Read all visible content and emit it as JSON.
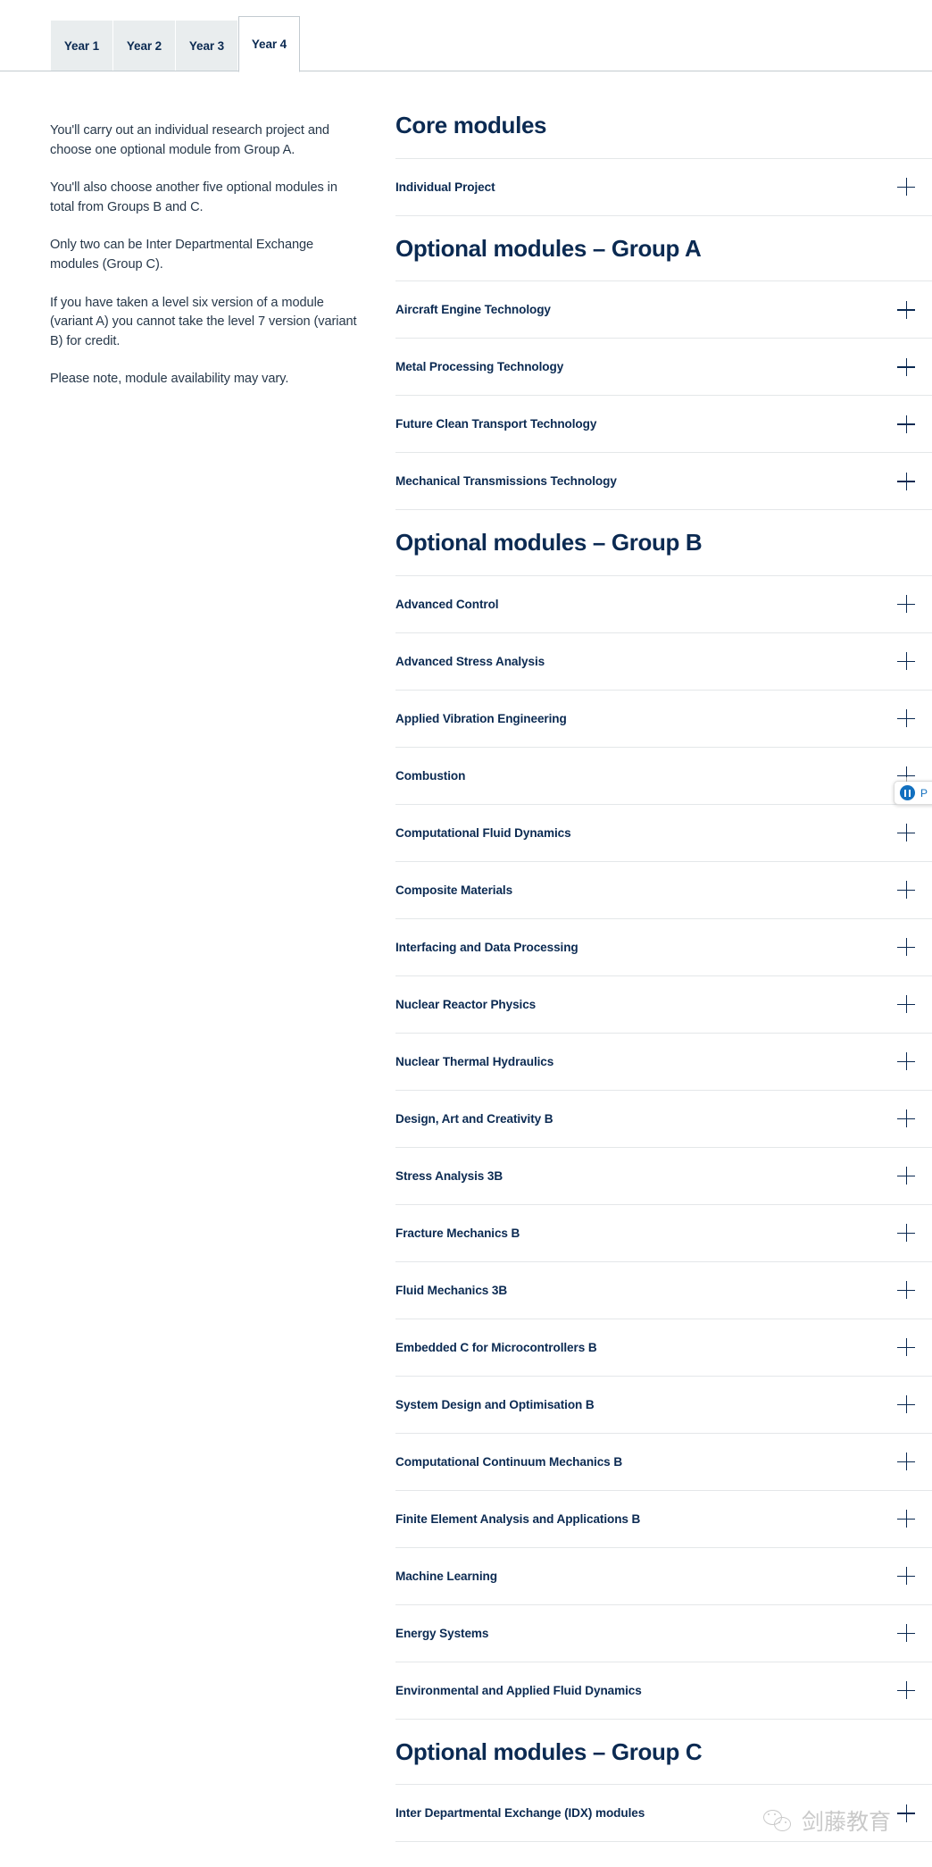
{
  "tabs": [
    {
      "label": "Year 1",
      "active": false
    },
    {
      "label": "Year 2",
      "active": false
    },
    {
      "label": "Year 3",
      "active": false
    },
    {
      "label": "Year 4",
      "active": true
    }
  ],
  "intro": {
    "paragraphs": [
      "You'll carry out an individual research project and choose one optional module from Group A.",
      "You'll also choose another five optional modules in total from Groups B and C.",
      "Only two can be Inter Departmental Exchange modules (Group C).",
      "If you have taken a level six version of a module (variant A) you cannot take the level 7 version (variant B) for credit.",
      "Please note, module availability may vary."
    ]
  },
  "module_groups": [
    {
      "heading": "Core modules",
      "modules": [
        {
          "title": "Individual Project",
          "expand_icon": "plus-icon"
        }
      ]
    },
    {
      "heading": "Optional modules – Group A",
      "modules": [
        {
          "title": "Aircraft Engine Technology",
          "expand_icon": "plus-icon"
        },
        {
          "title": "Metal Processing Technology",
          "expand_icon": "plus-icon"
        },
        {
          "title": "Future Clean Transport Technology",
          "expand_icon": "plus-icon"
        },
        {
          "title": "Mechanical Transmissions Technology",
          "expand_icon": "plus-icon"
        }
      ]
    },
    {
      "heading": "Optional modules – Group B",
      "modules": [
        {
          "title": "Advanced Control",
          "expand_icon": "plus-icon"
        },
        {
          "title": "Advanced Stress Analysis",
          "expand_icon": "plus-icon"
        },
        {
          "title": "Applied Vibration Engineering",
          "expand_icon": "plus-icon"
        },
        {
          "title": "Combustion",
          "expand_icon": "plus-icon"
        },
        {
          "title": "Computational Fluid Dynamics",
          "expand_icon": "plus-icon"
        },
        {
          "title": "Composite Materials",
          "expand_icon": "plus-icon"
        },
        {
          "title": "Interfacing and Data Processing",
          "expand_icon": "plus-icon"
        },
        {
          "title": "Nuclear Reactor Physics",
          "expand_icon": "plus-icon"
        },
        {
          "title": "Nuclear Thermal Hydraulics",
          "expand_icon": "plus-icon"
        },
        {
          "title": "Design, Art and Creativity B",
          "expand_icon": "plus-icon"
        },
        {
          "title": "Stress Analysis 3B",
          "expand_icon": "plus-icon"
        },
        {
          "title": "Fracture Mechanics B",
          "expand_icon": "plus-icon"
        },
        {
          "title": "Fluid Mechanics 3B",
          "expand_icon": "plus-icon"
        },
        {
          "title": "Embedded C for Microcontrollers B",
          "expand_icon": "plus-icon"
        },
        {
          "title": "System Design and Optimisation B",
          "expand_icon": "plus-icon"
        },
        {
          "title": "Computational Continuum Mechanics B",
          "expand_icon": "plus-icon"
        },
        {
          "title": "Finite Element Analysis and Applications B",
          "expand_icon": "plus-icon"
        },
        {
          "title": "Machine Learning",
          "expand_icon": "plus-icon"
        },
        {
          "title": "Energy Systems",
          "expand_icon": "plus-icon"
        },
        {
          "title": "Environmental and Applied Fluid Dynamics",
          "expand_icon": "plus-icon"
        }
      ]
    },
    {
      "heading": "Optional modules – Group C",
      "modules": [
        {
          "title": "Inter Departmental Exchange (IDX) modules",
          "expand_icon": "plus-icon"
        }
      ]
    }
  ],
  "media_pill": {
    "icon": "pause-circle-icon",
    "label": "P"
  },
  "watermark": {
    "icon": "wechat-icon",
    "text": "剑藤教育"
  },
  "colors": {
    "heading_navy": "#0b2a52",
    "body_text": "#27384a",
    "tab_inactive_bg": "#e9edee",
    "tab_border": "#c3cbd0",
    "divider": "#e4e7e9",
    "accent_blue": "#1270bf"
  }
}
